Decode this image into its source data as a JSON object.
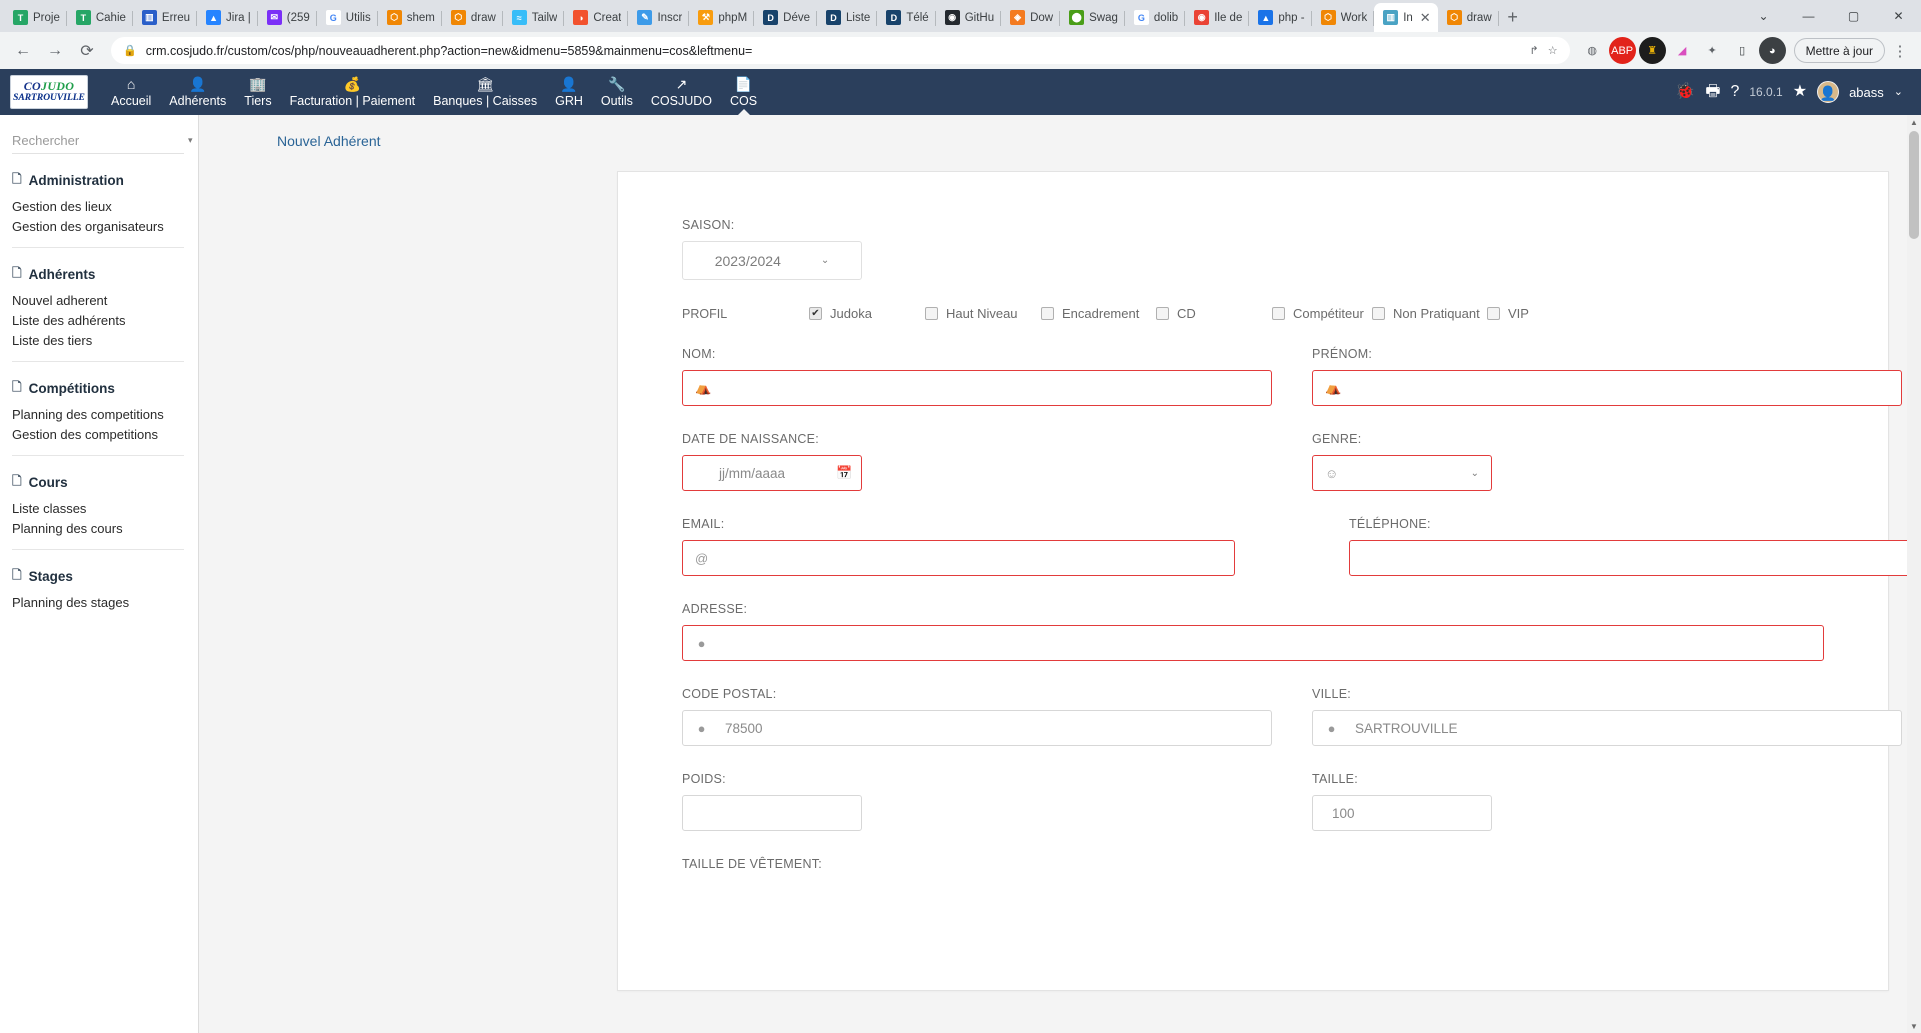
{
  "browser": {
    "tabs": [
      {
        "label": "Proje",
        "favicon": "trello-icon",
        "color": "#26a666",
        "glyph": "T"
      },
      {
        "label": "Cahie",
        "favicon": "trello-icon",
        "color": "#26a666",
        "glyph": "T"
      },
      {
        "label": "Erreu",
        "favicon": "trello-board-icon",
        "color": "#2a5fc9",
        "glyph": "▥"
      },
      {
        "label": "Jira |",
        "favicon": "jira-icon",
        "color": "#2684ff",
        "glyph": "▲"
      },
      {
        "label": "(259",
        "favicon": "mail-icon",
        "color": "#7b2ff7",
        "glyph": "✉"
      },
      {
        "label": "Utilis",
        "favicon": "google-icon",
        "color": "#ffffff",
        "glyph": "G"
      },
      {
        "label": "shem",
        "favicon": "drawio-icon",
        "color": "#f08705",
        "glyph": "⬡"
      },
      {
        "label": "draw",
        "favicon": "drawio-icon",
        "color": "#f08705",
        "glyph": "⬡"
      },
      {
        "label": "Tailw",
        "favicon": "tailwind-icon",
        "color": "#38bdf8",
        "glyph": "≈"
      },
      {
        "label": "Creat",
        "favicon": "creately-icon",
        "color": "#f2522e",
        "glyph": "◑"
      },
      {
        "label": "Inscr",
        "favicon": "pen-icon",
        "color": "#3d9be9",
        "glyph": "✎"
      },
      {
        "label": "phpM",
        "favicon": "phpmyadmin-icon",
        "color": "#f89c0e",
        "glyph": "⚒"
      },
      {
        "label": "Déve",
        "favicon": "dolibarr-icon",
        "color": "#18436b",
        "glyph": "D"
      },
      {
        "label": "Liste",
        "favicon": "dolibarr-icon",
        "color": "#18436b",
        "glyph": "D"
      },
      {
        "label": "Télé",
        "favicon": "dolibarr-icon",
        "color": "#18436b",
        "glyph": "D"
      },
      {
        "label": "GitHu",
        "favicon": "github-icon",
        "color": "#24292f",
        "glyph": "◉"
      },
      {
        "label": "Dow",
        "favicon": "download-icon",
        "color": "#f47b20",
        "glyph": "◈"
      },
      {
        "label": "Swag",
        "favicon": "swagger-icon",
        "color": "#4a9e18",
        "glyph": "⬤"
      },
      {
        "label": "dolib",
        "favicon": "google-icon",
        "color": "#ffffff",
        "glyph": "G"
      },
      {
        "label": "Ile de",
        "favicon": "maps-icon",
        "color": "#ea4335",
        "glyph": "◉"
      },
      {
        "label": "php -",
        "favicon": "drive-icon",
        "color": "#1a73e8",
        "glyph": "▲"
      },
      {
        "label": "Work",
        "favicon": "drawio-icon",
        "color": "#f08705",
        "glyph": "⬡"
      },
      {
        "label": "In",
        "favicon": "crm-icon",
        "color": "#4aa3c4",
        "glyph": "▥",
        "active": true
      },
      {
        "label": "draw",
        "favicon": "drawio-icon",
        "color": "#f08705",
        "glyph": "⬡"
      }
    ],
    "newtab_label": "+",
    "window_controls": [
      "⌄",
      "—",
      "▢",
      "✕"
    ],
    "nav": {
      "back": "←",
      "forward": "→",
      "reload": "⟳"
    },
    "url": "crm.cosjudo.fr/custom/cos/php/nouveauadherent.php?action=new&idmenu=5859&mainmenu=cos&leftmenu=",
    "lock_icon": "lock-icon",
    "share_icon": "share-icon",
    "bookmark_icon": "star-icon",
    "extensions": [
      {
        "name": "pocket-extension",
        "glyph": "◍",
        "color": "#5f6368",
        "bg": "transparent"
      },
      {
        "name": "adblock-plus-extension",
        "glyph": "ABP",
        "color": "#ffffff",
        "bg": "#e2231a"
      },
      {
        "name": "lastpass-extension",
        "glyph": "♜",
        "color": "#e8b007",
        "bg": "#1d1d1d"
      },
      {
        "name": "colorzilla-extension",
        "glyph": "◢",
        "color": "#d94fbf",
        "bg": "transparent"
      },
      {
        "name": "extensions-puzzle-icon",
        "glyph": "✦",
        "color": "#5f6368",
        "bg": "transparent"
      },
      {
        "name": "sidebar-toggle-icon",
        "glyph": "▯",
        "color": "#3c4043",
        "bg": "transparent"
      },
      {
        "name": "profile-avatar-icon",
        "glyph": "◕",
        "color": "#ffffff",
        "bg": "#3c4043"
      }
    ],
    "update_label": "Mettre à jour",
    "menu_icon": "⋮"
  },
  "appbar": {
    "logo": {
      "line1_blue": "CO",
      "line1_slash": "/",
      "line1_green": "JUDO",
      "line2": "SARTROUVILLE"
    },
    "items": [
      {
        "label": "Accueil",
        "icon": "home-icon",
        "glyph": "⌂"
      },
      {
        "label": "Adhérents",
        "icon": "user-icon",
        "glyph": "👤"
      },
      {
        "label": "Tiers",
        "icon": "building-icon",
        "glyph": "🏢"
      },
      {
        "label": "Facturation | Paiement",
        "icon": "money-icon",
        "glyph": "💰"
      },
      {
        "label": "Banques | Caisses",
        "icon": "bank-icon",
        "glyph": "🏛"
      },
      {
        "label": "GRH",
        "icon": "hr-user-icon",
        "glyph": "👤"
      },
      {
        "label": "Outils",
        "icon": "wrench-icon",
        "glyph": "🔧"
      },
      {
        "label": "COSJUDO",
        "icon": "link-icon",
        "glyph": "↗"
      },
      {
        "label": "COS",
        "icon": "page-icon",
        "glyph": "📄",
        "selected": true
      }
    ],
    "right": {
      "bug_icon": "bug-icon",
      "print_icon": "print-icon",
      "help_icon": "help-icon",
      "version": "16.0.1",
      "star_icon": "star-icon",
      "avatar": "avatar",
      "username": "abass",
      "caret": "⌄"
    }
  },
  "sidebar": {
    "search_placeholder": "Rechercher",
    "search_value": "",
    "groups": [
      {
        "title": "Administration",
        "items": [
          "Gestion des lieux",
          "Gestion des organisateurs"
        ]
      },
      {
        "title": "Adhérents",
        "items": [
          "Nouvel adherent",
          "Liste des adhérents",
          "Liste des tiers"
        ]
      },
      {
        "title": "Compétitions",
        "items": [
          "Planning des competitions",
          "Gestion des competitions"
        ]
      },
      {
        "title": "Cours",
        "items": [
          "Liste classes",
          "Planning des cours"
        ]
      },
      {
        "title": "Stages",
        "items": [
          "Planning des stages"
        ]
      }
    ]
  },
  "main": {
    "breadcrumb": "Nouvel Adhérent",
    "form": {
      "saison": {
        "label": "SAISON:",
        "value": "2023/2024",
        "caret": "⌄"
      },
      "profil": {
        "label": "PROFIL",
        "options": [
          {
            "label": "Judoka",
            "checked": true
          },
          {
            "label": "Haut Niveau",
            "checked": false
          },
          {
            "label": "Encadrement",
            "checked": false
          },
          {
            "label": "CD",
            "checked": false
          },
          {
            "label": "Compétiteur",
            "checked": false
          },
          {
            "label": "Non Pratiquant",
            "checked": false
          },
          {
            "label": "VIP",
            "checked": false
          }
        ]
      },
      "nom": {
        "label": "NOM:",
        "value": "",
        "icon": "person-icon",
        "glyph": "👤",
        "required": true
      },
      "prenom": {
        "label": "PRÉNOM:",
        "value": "",
        "icon": "person-icon",
        "glyph": "👤",
        "required": true
      },
      "date_naissance": {
        "label": "DATE DE NAISSANCE:",
        "placeholder": "jj/mm/aaaa",
        "value": "",
        "icon": "calendar-icon",
        "glyph": "📅",
        "required": true
      },
      "genre": {
        "label": "GENRE:",
        "value": "",
        "icon": "face-icon",
        "glyph": "☺",
        "caret": "⌄",
        "required": true
      },
      "email": {
        "label": "EMAIL:",
        "value": "",
        "icon": "at-icon",
        "glyph": "@",
        "required": true
      },
      "telephone": {
        "label": "TÉLÉPHONE:",
        "value": "",
        "required": true
      },
      "adresse": {
        "label": "ADRESSE:",
        "value": "",
        "icon": "map-pin-icon",
        "glyph": "📍",
        "required": true
      },
      "code_postal": {
        "label": "CODE POSTAL:",
        "value": "78500",
        "icon": "map-pin-icon",
        "glyph": "📍",
        "required": false
      },
      "ville": {
        "label": "VILLE:",
        "value": "SARTROUVILLE",
        "icon": "map-pin-icon",
        "glyph": "📍",
        "required": false
      },
      "poids": {
        "label": "POIDS:",
        "value": "",
        "required": false
      },
      "taille": {
        "label": "TAILLE:",
        "value": "100",
        "required": false
      },
      "taille_vetement": {
        "label": "TAILLE DE VÊTEMENT:"
      }
    }
  }
}
